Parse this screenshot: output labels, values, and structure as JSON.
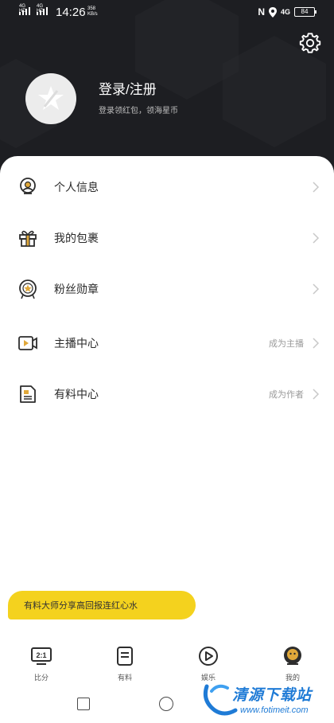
{
  "status_bar": {
    "signal1_label": "4G HD",
    "signal2_label": "4G HD",
    "time": "14:26",
    "net_speed_value": "358",
    "net_speed_unit": "KB/s",
    "nfc_icon": "N",
    "network_label": "4G",
    "battery_level": "84"
  },
  "profile": {
    "title": "登录/注册",
    "subtitle": "登录领红包，领海星币",
    "avatar_icon": "star-logo-icon",
    "settings_icon": "gear-icon"
  },
  "menu": [
    {
      "icon": "user-avatar-icon",
      "label": "个人信息",
      "right": ""
    },
    {
      "icon": "gift-icon",
      "label": "我的包裹",
      "right": ""
    },
    {
      "icon": "fan-badge-icon",
      "label": "粉丝勋章",
      "right": ""
    },
    {
      "icon": "video-camera-icon",
      "label": "主播中心",
      "right": "成为主播"
    },
    {
      "icon": "document-icon",
      "label": "有料中心",
      "right": "成为作者"
    }
  ],
  "promo": {
    "text": "有料大师分享高回报连红心水",
    "color": "#f4d21e"
  },
  "tabbar": [
    {
      "icon": "scoreboard-icon",
      "icon_text": "2:1",
      "label": "比分"
    },
    {
      "icon": "notebook-icon",
      "label": "有料"
    },
    {
      "icon": "play-circle-icon",
      "label": "娱乐"
    },
    {
      "icon": "profile-avatar-icon",
      "label": "我的"
    }
  ],
  "watermark": {
    "text": "清源下载站",
    "url": "www.fotimeit.com"
  },
  "colors": {
    "header_bg": "#1d1e22",
    "accent": "#f4d21e"
  }
}
